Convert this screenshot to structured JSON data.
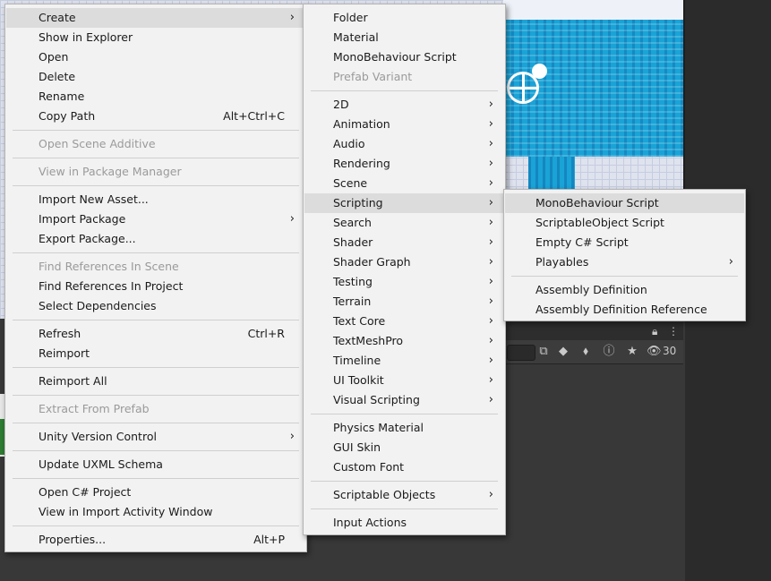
{
  "main_menu": {
    "items": [
      {
        "label": "Create",
        "arrow": "›"
      },
      {
        "label": "Show in Explorer"
      },
      {
        "label": "Open"
      },
      {
        "label": "Delete"
      },
      {
        "label": "Rename"
      },
      {
        "label": "Copy Path",
        "shortcut": "Alt+Ctrl+C"
      },
      {
        "label": "Open Scene Additive",
        "disabled": true
      },
      {
        "label": "View in Package Manager",
        "disabled": true
      },
      {
        "label": "Import New Asset..."
      },
      {
        "label": "Import Package",
        "arrow": "›"
      },
      {
        "label": "Export Package..."
      },
      {
        "label": "Find References In Scene",
        "disabled": true
      },
      {
        "label": "Find References In Project"
      },
      {
        "label": "Select Dependencies"
      },
      {
        "label": "Refresh",
        "shortcut": "Ctrl+R"
      },
      {
        "label": "Reimport"
      },
      {
        "label": "Reimport All"
      },
      {
        "label": "Extract From Prefab",
        "disabled": true
      },
      {
        "label": "Unity Version Control",
        "arrow": "›"
      },
      {
        "label": "Update UXML Schema"
      },
      {
        "label": "Open C# Project"
      },
      {
        "label": "View in Import Activity Window"
      },
      {
        "label": "Properties...",
        "shortcut": "Alt+P"
      }
    ]
  },
  "create_menu": {
    "items": [
      {
        "label": "Folder"
      },
      {
        "label": "Material"
      },
      {
        "label": "MonoBehaviour Script"
      },
      {
        "label": "Prefab Variant",
        "disabled": true
      },
      {
        "label": "2D",
        "arrow": "›"
      },
      {
        "label": "Animation",
        "arrow": "›"
      },
      {
        "label": "Audio",
        "arrow": "›"
      },
      {
        "label": "Rendering",
        "arrow": "›"
      },
      {
        "label": "Scene",
        "arrow": "›"
      },
      {
        "label": "Scripting",
        "arrow": "›"
      },
      {
        "label": "Search",
        "arrow": "›"
      },
      {
        "label": "Shader",
        "arrow": "›"
      },
      {
        "label": "Shader Graph",
        "arrow": "›"
      },
      {
        "label": "Testing",
        "arrow": "›"
      },
      {
        "label": "Terrain",
        "arrow": "›"
      },
      {
        "label": "Text Core",
        "arrow": "›"
      },
      {
        "label": "TextMeshPro",
        "arrow": "›"
      },
      {
        "label": "Timeline",
        "arrow": "›"
      },
      {
        "label": "UI Toolkit",
        "arrow": "›"
      },
      {
        "label": "Visual Scripting",
        "arrow": "›"
      },
      {
        "label": "Physics Material"
      },
      {
        "label": "GUI Skin"
      },
      {
        "label": "Custom Font"
      },
      {
        "label": "Scriptable Objects",
        "arrow": "›"
      },
      {
        "label": "Input Actions"
      }
    ]
  },
  "scripting_menu": {
    "items": [
      {
        "label": "MonoBehaviour Script"
      },
      {
        "label": "ScriptableObject Script"
      },
      {
        "label": "Empty C# Script"
      },
      {
        "label": "Playables",
        "arrow": "›"
      },
      {
        "label": "Assembly Definition"
      },
      {
        "label": "Assembly Definition Reference"
      }
    ]
  },
  "toolbar": {
    "visibility_count": "30",
    "icons": [
      "lock-icon",
      "more-icon",
      "open-in-window-icon",
      "shapes-icon",
      "tag-icon",
      "warning-icon",
      "star-icon",
      "eye-icon"
    ]
  },
  "colors": {
    "menu_bg": "#f2f2f2",
    "highlight": "#dcdcdc",
    "disabled_text": "#9a9a9a",
    "editor_dark": "#383838",
    "water": "#1aa3d6"
  }
}
